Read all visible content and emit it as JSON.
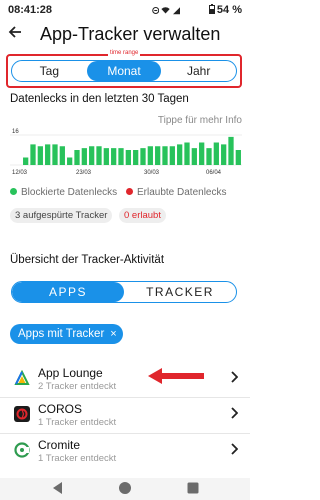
{
  "status_bar": {
    "time": "08:41:28",
    "battery": "54 %"
  },
  "app_bar": {
    "title": "App-Tracker verwalten",
    "back_icon": "arrow-left-icon"
  },
  "annotation": {
    "label": "time range",
    "color": "#e0262c"
  },
  "time_range": {
    "options": [
      "Tag",
      "Monat",
      "Jahr"
    ],
    "selected": "Monat"
  },
  "leaks": {
    "title": "Datenlecks in den letzten 30 Tagen",
    "tap_hint": "Tippe für mehr Info"
  },
  "chart_data": {
    "type": "bar",
    "ymax_label": "16",
    "ylim": [
      0,
      16
    ],
    "x_tick_labels": [
      "12/03",
      "23/03",
      "30/03",
      "06/04"
    ],
    "values": [
      4,
      11,
      10,
      11,
      11,
      10,
      4,
      8,
      9,
      10,
      10,
      9,
      9,
      9,
      8,
      8,
      9,
      10,
      10,
      10,
      10,
      11,
      12,
      9,
      12,
      9,
      12,
      11,
      15,
      8
    ],
    "bar_color": "#28c25b",
    "grid_color": "#d9d9d9",
    "legend": [
      {
        "name": "Blockierte Datenlecks",
        "color": "#28c25b"
      },
      {
        "name": "Erlaubte Datenlecks",
        "color": "#e0262c"
      }
    ]
  },
  "chips": {
    "tracked": "3 aufgespürte Tracker",
    "allowed": "0 erlaubt"
  },
  "overview": {
    "title": "Übersicht der Tracker-Aktivität",
    "tabs": [
      "APPS",
      "TRACKER"
    ],
    "selected_tab": "APPS"
  },
  "filter": {
    "label": "Apps mit Tracker",
    "close": "×"
  },
  "apps": [
    {
      "name": "App Lounge",
      "sub": "2 Tracker entdeckt"
    },
    {
      "name": "COROS",
      "sub": "1 Tracker entdeckt"
    },
    {
      "name": "Cromite",
      "sub": "1 Tracker entdeckt"
    }
  ],
  "colors": {
    "accent": "#1a91e8",
    "annotation_red": "#e0262c"
  }
}
